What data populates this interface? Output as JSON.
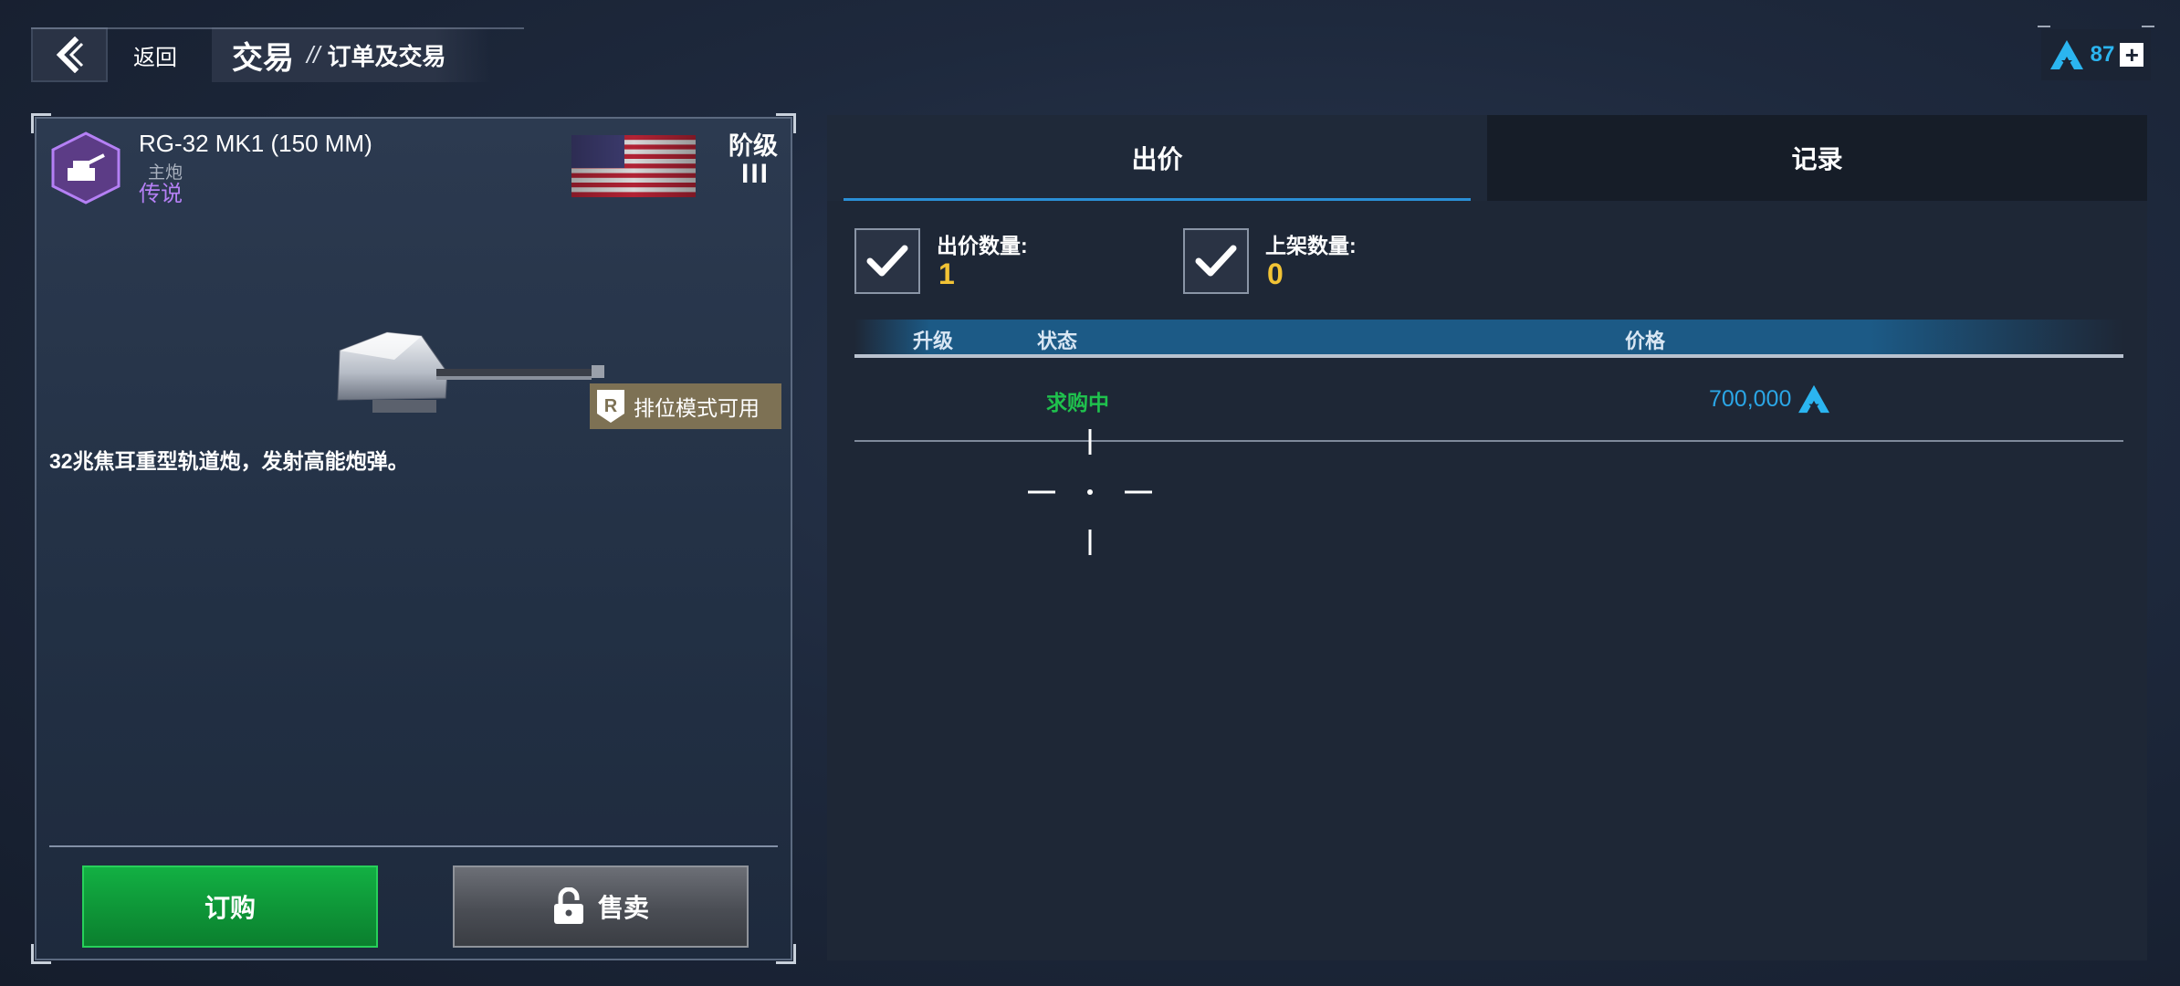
{
  "header": {
    "back_label": "返回",
    "title": "交易",
    "separator": "//",
    "subtitle": "订单及交易"
  },
  "currency": {
    "icon": "a-logo-icon",
    "value": "87",
    "add_icon": "plus-icon",
    "color": "#2bb5f0"
  },
  "item": {
    "name": "RG-32 MK1 (150 MM)",
    "type": "主炮",
    "rarity": "传说",
    "rarity_color": "#b580f5",
    "nation_flag": "usa-flag",
    "tier_label": "阶级",
    "tier_value": "III",
    "ranked_badge": "排位模式可用",
    "description": "32兆焦耳重型轨道炮，发射高能炮弹。"
  },
  "actions": {
    "buy_label": "订购",
    "sell_label": "售卖",
    "sell_icon": "lock-icon"
  },
  "tabs": [
    {
      "label": "出价",
      "active": true
    },
    {
      "label": "记录",
      "active": false
    }
  ],
  "stats": {
    "bid_qty_label": "出价数量:",
    "bid_qty_value": "1",
    "listed_qty_label": "上架数量:",
    "listed_qty_value": "0"
  },
  "table": {
    "headers": [
      "升级",
      "状态",
      "价格"
    ],
    "rows": [
      {
        "upgrade": "",
        "status": "求购中",
        "price": "700,000"
      }
    ]
  }
}
